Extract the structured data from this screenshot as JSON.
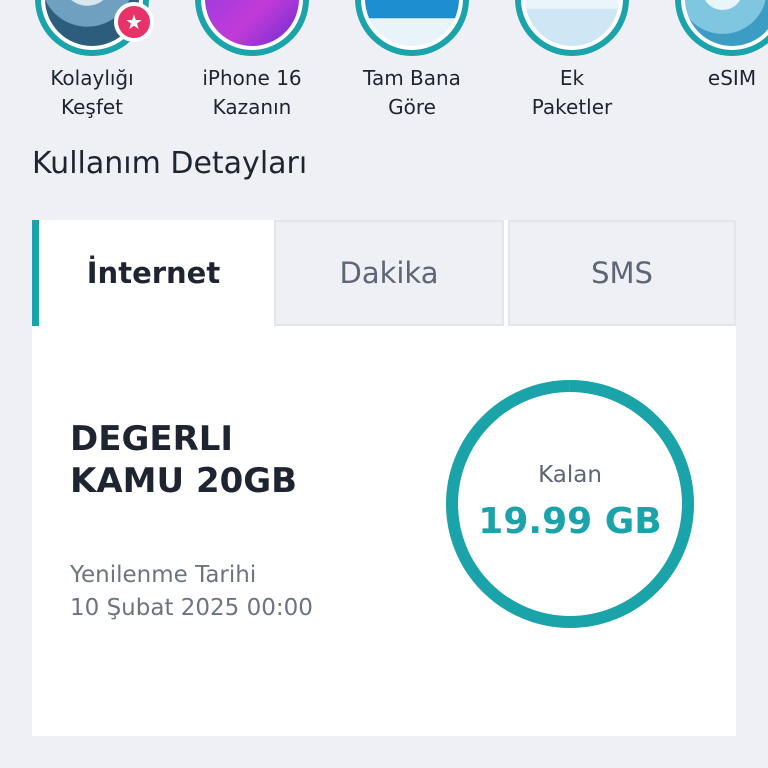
{
  "stories": [
    {
      "line1": "Kolaylığı",
      "line2": "Keşfet",
      "has_badge": true
    },
    {
      "line1": "iPhone 16",
      "line2": "Kazanın",
      "has_badge": false
    },
    {
      "line1": "Tam Bana",
      "line2": "Göre",
      "has_badge": false
    },
    {
      "line1": "Ek",
      "line2": "Paketler",
      "has_badge": false
    },
    {
      "line1": "eSIM",
      "line2": "",
      "has_badge": false
    }
  ],
  "badge_icon": "star-icon",
  "section_title": "Kullanım Detayları",
  "tabs": [
    {
      "label": "İnternet",
      "active": true
    },
    {
      "label": "Dakika",
      "active": false
    },
    {
      "label": "SMS",
      "active": false
    }
  ],
  "package": {
    "name_line1": "DEGERLI",
    "name_line2": "KAMU 20GB",
    "renewal_label": "Yenilenme Tarihi",
    "renewal_date": "10 Şubat 2025 00:00"
  },
  "usage": {
    "remaining_label": "Kalan",
    "remaining_value": "19.99 GB",
    "remaining_fraction": 0.9995
  },
  "colors": {
    "accent": "#1aa3a8",
    "badge": "#e8336a",
    "background": "#eef0f5"
  }
}
